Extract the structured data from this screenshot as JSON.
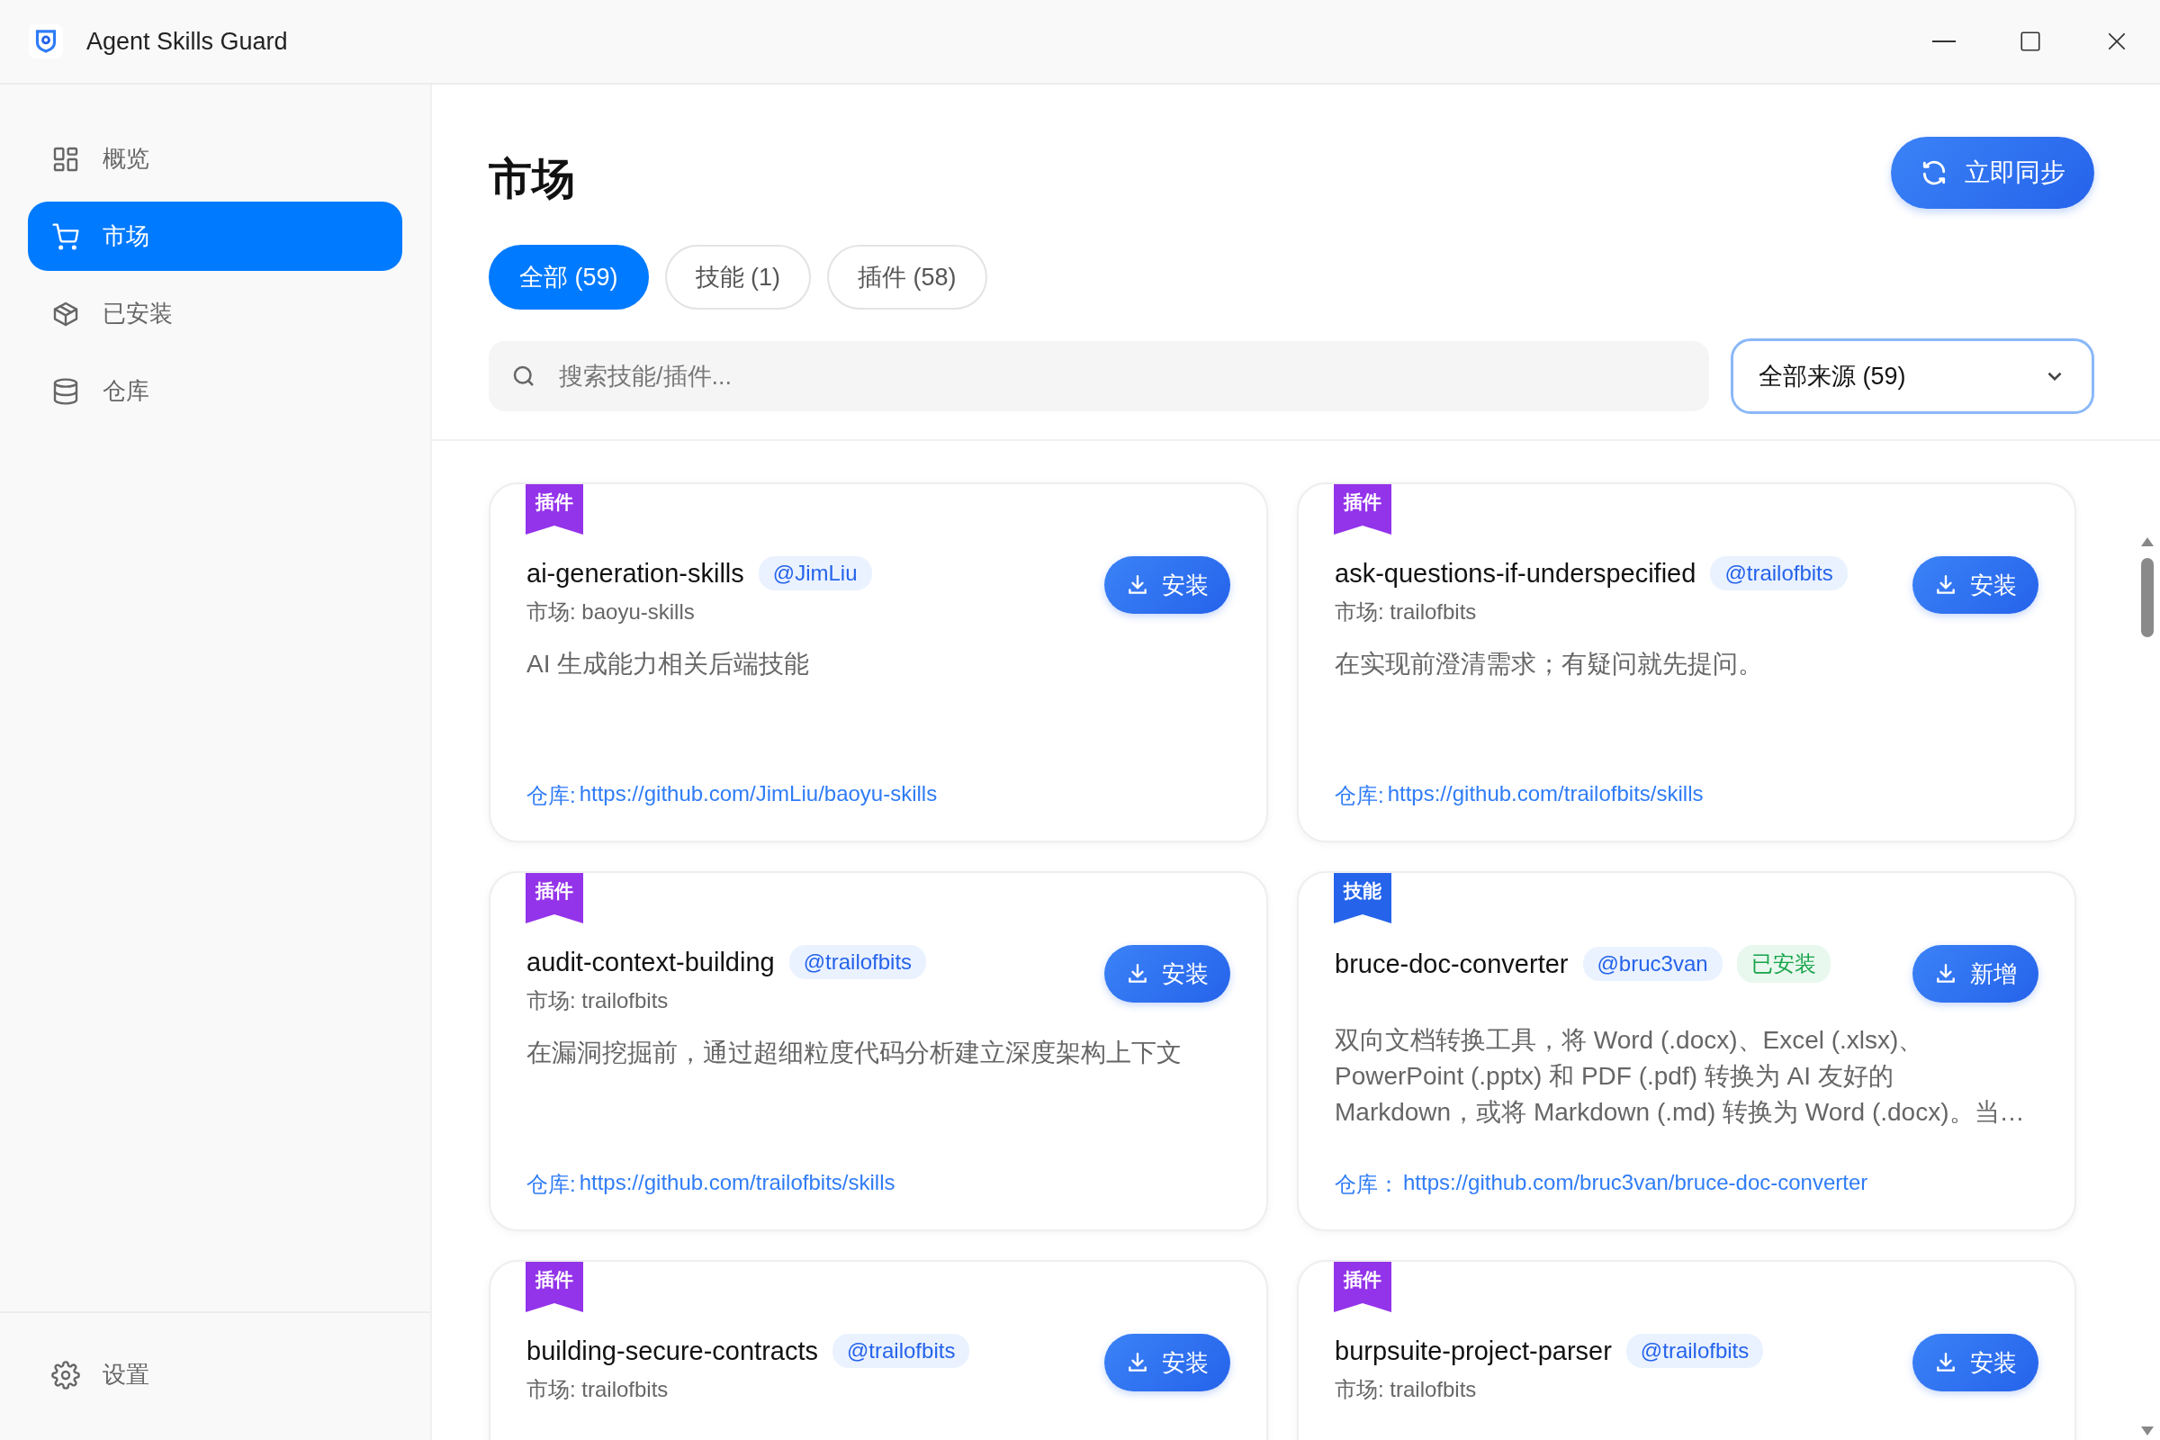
{
  "window": {
    "title": "Agent Skills Guard"
  },
  "sidebar": {
    "items": [
      {
        "label": "概览",
        "selected": false
      },
      {
        "label": "市场",
        "selected": true
      },
      {
        "label": "已安装",
        "selected": false
      },
      {
        "label": "仓库",
        "selected": false
      }
    ],
    "footer": {
      "label": "设置"
    }
  },
  "page": {
    "title": "市场",
    "sync_button": "立即同步"
  },
  "tabs": [
    {
      "label": "全部 (59)",
      "selected": true
    },
    {
      "label": "技能 (1)",
      "selected": false
    },
    {
      "label": "插件 (58)",
      "selected": false
    }
  ],
  "search": {
    "placeholder": "搜索技能/插件..."
  },
  "source_select": {
    "value": "全部来源 (59)"
  },
  "cards": [
    {
      "tag": {
        "label": "插件",
        "kind": "plugin"
      },
      "name": "ai-generation-skills",
      "author": "@JimLiu",
      "market": "市场: baoyu-skills",
      "button": "安装",
      "description": "AI 生成能力相关后端技能",
      "repo_label": "仓库:",
      "repo_url": "https://github.com/JimLiu/baoyu-skills"
    },
    {
      "tag": {
        "label": "插件",
        "kind": "plugin"
      },
      "name": "ask-questions-if-underspecified",
      "author": "@trailofbits",
      "market": "市场: trailofbits",
      "button": "安装",
      "description": "在实现前澄清需求；有疑问就先提问。",
      "repo_label": "仓库:",
      "repo_url": "https://github.com/trailofbits/skills"
    },
    {
      "tag": {
        "label": "插件",
        "kind": "plugin"
      },
      "name": "audit-context-building",
      "author": "@trailofbits",
      "market": "市场: trailofbits",
      "button": "安装",
      "description": "在漏洞挖掘前，通过超细粒度代码分析建立深度架构上下文",
      "repo_label": "仓库:",
      "repo_url": "https://github.com/trailofbits/skills"
    },
    {
      "tag": {
        "label": "技能",
        "kind": "skill"
      },
      "name": "bruce-doc-converter",
      "author": "@bruc3van",
      "installed_badge": "已安装",
      "button": "新增",
      "description": "双向文档转换工具，将 Word (.docx)、Excel (.xlsx)、PowerPoint (.pptx) 和 PDF (.pdf) 转换为 AI 友好的 Markdown，或将 Markdown (.md) 转换为 Word (.docx)。当…",
      "repo_label": "仓库：",
      "repo_url": "https://github.com/bruc3van/bruce-doc-converter"
    },
    {
      "tag": {
        "label": "插件",
        "kind": "plugin"
      },
      "name": "building-secure-contracts",
      "author": "@trailofbits",
      "market": "市场: trailofbits",
      "button": "安装"
    },
    {
      "tag": {
        "label": "插件",
        "kind": "plugin"
      },
      "name": "burpsuite-project-parser",
      "author": "@trailofbits",
      "market": "市场: trailofbits",
      "button": "安装"
    }
  ]
}
